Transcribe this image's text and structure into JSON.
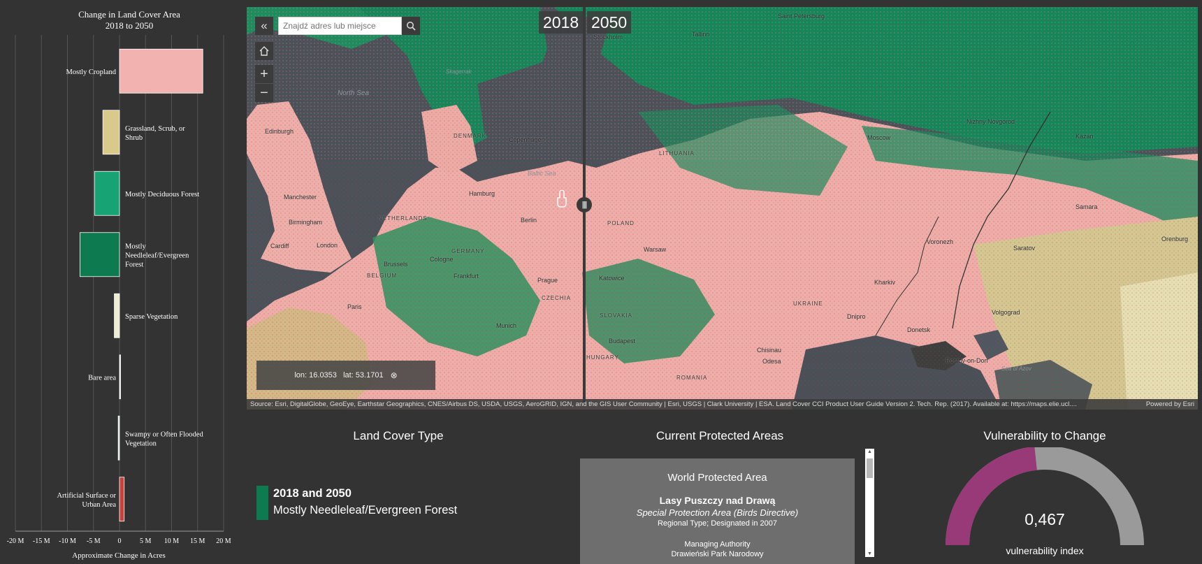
{
  "colors": {
    "cropland": "#f2b3b0",
    "grassland": "#d9c98a",
    "deciduous": "#17a374",
    "needleleaf": "#0d7a4f",
    "sparse": "#eeecd2",
    "bare": "#f4f4f4",
    "swampy": "#d8e6e3",
    "urban": "#c9403d",
    "gauge_fill": "#983a78",
    "gauge_track": "#9a9a9a"
  },
  "chart_data": {
    "type": "bar",
    "orientation": "horizontal",
    "title": "Change in Land Cover Area",
    "subtitle": "2018 to 2050",
    "xlabel": "Approximate Change in Acres",
    "xlim": [
      -20000000,
      20000000
    ],
    "xticks": [
      "-20 M",
      "-15 M",
      "-10 M",
      "-5 M",
      "0",
      "5 M",
      "10 M",
      "15 M",
      "20 M"
    ],
    "categories": [
      {
        "label": [
          "Mostly Cropland"
        ],
        "value": 16000000,
        "color_key": "cropland"
      },
      {
        "label": [
          "Grassland, Scrub, or",
          "Shrub"
        ],
        "value": -3200000,
        "color_key": "grassland"
      },
      {
        "label": [
          "Mostly Deciduous Forest"
        ],
        "value": -4800000,
        "color_key": "deciduous"
      },
      {
        "label": [
          "Mostly",
          "Needleleaf/Evergreen",
          "Forest"
        ],
        "value": -7600000,
        "color_key": "needleleaf"
      },
      {
        "label": [
          "Sparse Vegetation"
        ],
        "value": -1000000,
        "color_key": "sparse"
      },
      {
        "label": [
          "Bare area"
        ],
        "value": 200000,
        "color_key": "bare"
      },
      {
        "label": [
          "Swampy or Often Flooded",
          "Vegetation"
        ],
        "value": -250000,
        "color_key": "swampy"
      },
      {
        "label": [
          "Artificial Surface or",
          "Urban Area"
        ],
        "value": 900000,
        "color_key": "urban"
      }
    ]
  },
  "map": {
    "search_placeholder": "Znajdź adres lub miejsce",
    "year_left": "2018",
    "year_right": "2050",
    "coords": "lon: 16.0353   lat: 53.1701",
    "attribution": "Source: Esri, DigitalGlobe, GeoEye, Earthstar Geographics, CNES/Airbus DS, USDA, USGS, AeroGRID, IGN, and the GIS User Community | Esri, USGS | Clark University | ESA. Land Cover CCI Product User Guide Version 2. Tech. Rep. (2017). Available at: https://maps.elie.ucl....",
    "powered_by": "Powered by Esri",
    "labels": {
      "north_sea": "North Sea",
      "skagerrak": "Skagerrak",
      "baltic": "Baltic Sea",
      "azov": "Sea of Azov",
      "st_petersburg": "Saint Petersburg",
      "tallinn": "Tallinn",
      "stockholm": "Stockholm",
      "copenhagen": "Copenhagen",
      "denmark": "DENMARK",
      "lithuania": "LITHUANIA",
      "edinburgh": "Edinburgh",
      "manchester": "Manchester",
      "birmingham": "Birmingham",
      "cardiff": "Cardiff",
      "london": "London",
      "hamburg": "Hamburg",
      "netherlands": "NETHERLANDS",
      "berlin": "Berlin",
      "germany": "GERMANY",
      "poland": "POLAND",
      "warsaw": "Warsaw",
      "cologne": "Cologne",
      "brussels": "Brussels",
      "belgium": "BELGIUM",
      "frankfurt": "Frankfurt",
      "prague": "Prague",
      "czechia": "CZECHIA",
      "katowice": "Katowice",
      "paris": "Paris",
      "munich": "Munich",
      "slovakia": "SLOVAKIA",
      "budapest": "Budapest",
      "hungary": "HUNGARY",
      "romania": "ROMANIA",
      "ukraine": "UKRAINE",
      "chisinau": "Chisinau",
      "odesa": "Odesa",
      "dnipro": "Dnipro",
      "kharkiv": "Kharkiv",
      "donetsk": "Donetsk",
      "voronezh": "Voronezh",
      "moscow": "Moscow",
      "nizhny": "Nizhny Novgorod",
      "kazan": "Kazan",
      "samara": "Samara",
      "saratov": "Saratov",
      "volgograd": "Volgograd",
      "rostov": "Rostov-on-Don",
      "orenburg": "Orenburg"
    }
  },
  "legend": {
    "title": "Land Cover Type",
    "line1": "2018 and 2050",
    "line2": "Mostly Needleleaf/Evergreen Forest"
  },
  "protected": {
    "title": "Current Protected Areas",
    "header": "World Protected Area",
    "name": "Lasy Puszczy nad Drawą",
    "designation": "Special Protection Area (Birds Directive)",
    "type_line": "Regional Type; Designated in 2007",
    "ma_label": "Managing Authority",
    "ma_value": "Drawieński Park Narodowy"
  },
  "vulnerability": {
    "title": "Vulnerability to Change",
    "value_text": "0,467",
    "value": 0.467,
    "label": "vulnerability index"
  }
}
